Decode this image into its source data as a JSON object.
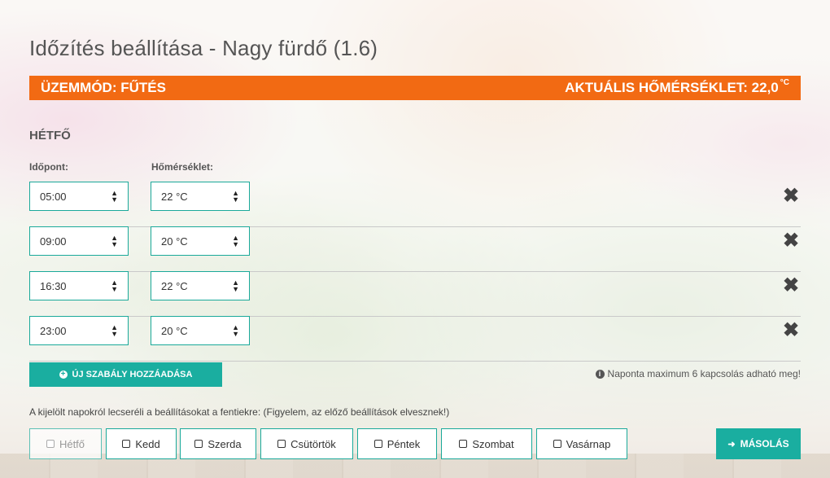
{
  "title": "Időzítés beállítása - Nagy fürdő (1.6)",
  "modebar": {
    "mode": "ÜZEMMÓD: FŰTÉS",
    "current_temp": "AKTUÁLIS HŐMÉRSÉKLET: 22,0",
    "unit": "°C",
    "color": "#f26a13"
  },
  "day_heading": "HÉTFŐ",
  "columns": {
    "time": "Időpont:",
    "temperature": "Hőmérséklet:"
  },
  "rules": [
    {
      "time": "05:00",
      "temp": "22 °C"
    },
    {
      "time": "09:00",
      "temp": "20 °C"
    },
    {
      "time": "16:30",
      "temp": "22 °C"
    },
    {
      "time": "23:00",
      "temp": "20 °C"
    }
  ],
  "icons": {
    "delete": "close-icon",
    "add": "plus-circle-icon",
    "info": "info-circle-icon",
    "copy": "sign-in-icon",
    "select": "select-arrows-icon"
  },
  "add_button": "ÚJ SZABÁLY HOZZÁADÁSA",
  "info_text": "Naponta maximum 6 kapcsolás adható meg!",
  "copy_text": "A kijelölt napokról lecseréli a beállításokat a fentiekre: (Figyelem, az előző beállítások elvesznek!)",
  "days": [
    {
      "label": "Hétfő",
      "disabled": true
    },
    {
      "label": "Kedd",
      "disabled": false
    },
    {
      "label": "Szerda",
      "disabled": false
    },
    {
      "label": "Csütörtök",
      "disabled": false
    },
    {
      "label": "Péntek",
      "disabled": false
    },
    {
      "label": "Szombat",
      "disabled": false
    },
    {
      "label": "Vasárnap",
      "disabled": false
    }
  ],
  "copy_button": "MÁSOLÁS",
  "accent_color": "#1aaea0"
}
